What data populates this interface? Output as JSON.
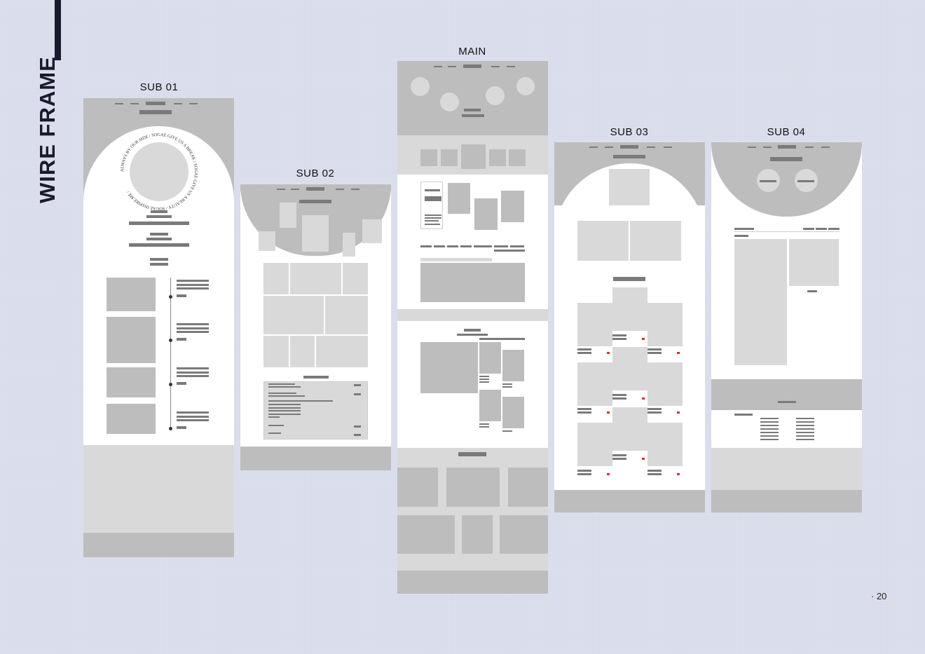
{
  "page": {
    "title": "WIRE FRAME",
    "page_number": "· 20"
  },
  "frames": {
    "sub01": {
      "label": "SUB 01",
      "ring_text": "ALWAYS BY OUR SIDE / SOGAE GIVE US A BREAK / SOGAE GIVE US A BEAUTY / SOGAE INSPIRE ME /"
    },
    "sub02": {
      "label": "SUB 02"
    },
    "main": {
      "label": "MAIN"
    },
    "sub03": {
      "label": "SUB 03"
    },
    "sub04": {
      "label": "SUB 04"
    }
  },
  "colors": {
    "background": "#d8dbea",
    "frame": "#ffffff",
    "block": "#bdbdbd",
    "text_bar": "#7a7a7a",
    "light_block": "#d9d9d9",
    "accent": "#d0342c"
  }
}
